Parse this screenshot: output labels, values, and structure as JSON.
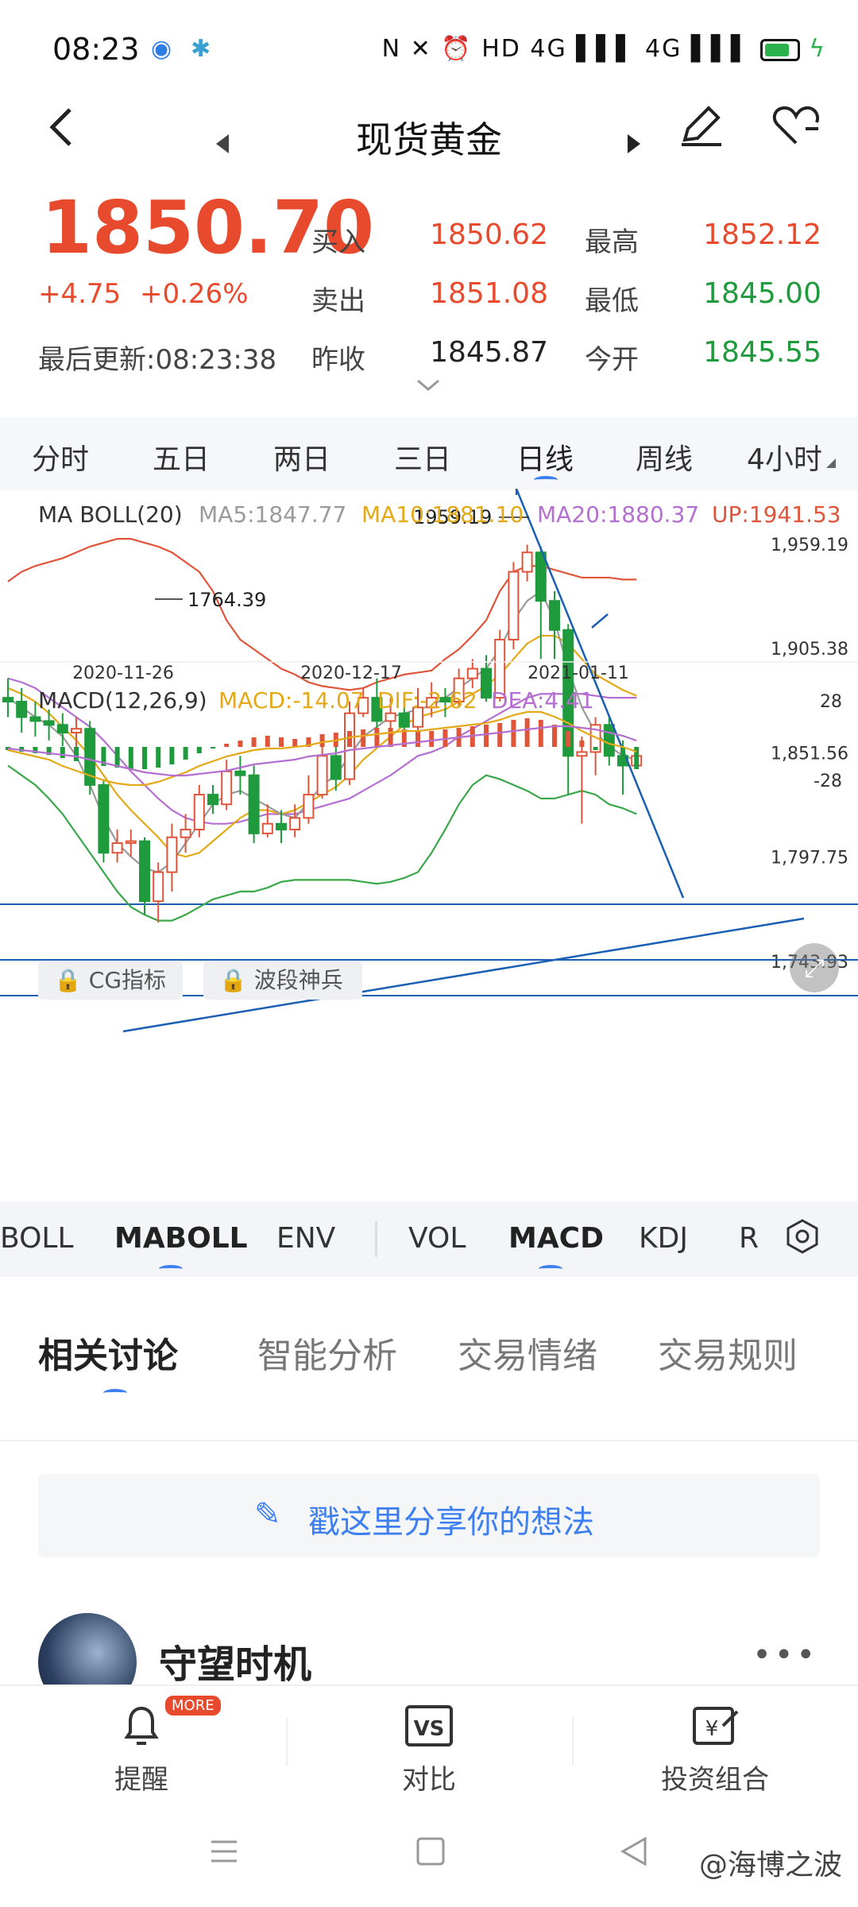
{
  "status_bar": {
    "time": "08:23",
    "right_icons": "N ✕ ⏰ HD 4G ▌▌▌ 4G ▌▌▌"
  },
  "nav": {
    "title": "现货黄金",
    "back_icon": "chevron-left-icon",
    "prev_icon": "triangle-left-icon",
    "next_icon": "triangle-right-icon",
    "edit_icon": "pen-icon",
    "fav_icon": "heart-icon"
  },
  "quote": {
    "price": "1850.70",
    "change": "+4.75",
    "change_pct": "+0.26%",
    "updated": "最后更新:08:23:38",
    "buy_label": "买入",
    "buy_value": "1850.62",
    "sell_label": "卖出",
    "sell_value": "1851.08",
    "prev_close_label": "昨收",
    "prev_close_value": "1845.87",
    "high_label": "最高",
    "high_value": "1852.12",
    "low_label": "最低",
    "low_value": "1845.00",
    "open_label": "今开",
    "open_value": "1845.55",
    "expand_icon": "chevron-down-icon"
  },
  "period_tabs": [
    "分时",
    "五日",
    "两日",
    "三日",
    "日线",
    "周线",
    "4小时"
  ],
  "period_active": "日线",
  "indicator_header": {
    "name": "MA BOLL(20)",
    "ma5": "MA5:1847.77",
    "ma10": "MA10:1881.10",
    "ma20": "MA20:1880.37",
    "up": "UP:1941.53"
  },
  "macd_header": {
    "name": "MACD(12,26,9)",
    "macd": "MACD:-14.07",
    "dif": "DIF:-2.62",
    "dea": "DEA:4.41"
  },
  "chart_badges": [
    "CG指标",
    "波段神兵"
  ],
  "colors": {
    "ma5": "#9a9a9a",
    "ma10": "#e3a917",
    "ma20": "#b46fd1",
    "up": "#e0553a",
    "low": "#3aa84a",
    "up_candle": "#e0553a",
    "down_candle": "#1f9a3c",
    "trend_line": "#1a5fb4"
  },
  "chart_data": {
    "type": "line",
    "price_axis": [
      "1,959.19",
      "1,905.38",
      "1,851.56",
      "1,797.75",
      "1,743.93"
    ],
    "date_axis": [
      "2020-11-26",
      "2020-12-17",
      "2021-01-11"
    ],
    "annotations": [
      "1959.19",
      "1764.39"
    ],
    "macd_axis": [
      "28",
      "-28"
    ],
    "candles": [
      [
        1880,
        1878,
        1890,
        1870
      ],
      [
        1878,
        1870,
        1885,
        1862
      ],
      [
        1870,
        1868,
        1878,
        1860
      ],
      [
        1868,
        1866,
        1874,
        1858
      ],
      [
        1866,
        1862,
        1872,
        1855
      ],
      [
        1862,
        1864,
        1870,
        1852
      ],
      [
        1864,
        1835,
        1868,
        1830
      ],
      [
        1835,
        1800,
        1838,
        1795
      ],
      [
        1800,
        1805,
        1812,
        1795
      ],
      [
        1805,
        1806,
        1812,
        1798
      ],
      [
        1806,
        1775,
        1808,
        1768
      ],
      [
        1775,
        1790,
        1795,
        1764
      ],
      [
        1790,
        1808,
        1815,
        1780
      ],
      [
        1808,
        1812,
        1820,
        1800
      ],
      [
        1812,
        1830,
        1835,
        1808
      ],
      [
        1830,
        1825,
        1835,
        1820
      ],
      [
        1825,
        1842,
        1848,
        1822
      ],
      [
        1842,
        1840,
        1850,
        1830
      ],
      [
        1840,
        1810,
        1845,
        1805
      ],
      [
        1810,
        1815,
        1825,
        1808
      ],
      [
        1815,
        1812,
        1822,
        1805
      ],
      [
        1812,
        1818,
        1825,
        1808
      ],
      [
        1818,
        1830,
        1840,
        1815
      ],
      [
        1830,
        1850,
        1860,
        1828
      ],
      [
        1850,
        1838,
        1855,
        1832
      ],
      [
        1838,
        1872,
        1878,
        1835
      ],
      [
        1872,
        1880,
        1885,
        1870
      ],
      [
        1880,
        1868,
        1890,
        1862
      ],
      [
        1868,
        1872,
        1880,
        1860
      ],
      [
        1872,
        1865,
        1880,
        1858
      ],
      [
        1865,
        1875,
        1885,
        1860
      ],
      [
        1875,
        1880,
        1888,
        1870
      ],
      [
        1880,
        1878,
        1885,
        1870
      ],
      [
        1878,
        1890,
        1895,
        1875
      ],
      [
        1890,
        1895,
        1900,
        1885
      ],
      [
        1895,
        1880,
        1902,
        1878
      ],
      [
        1880,
        1910,
        1915,
        1878
      ],
      [
        1910,
        1945,
        1950,
        1905
      ],
      [
        1945,
        1955,
        1959,
        1940
      ],
      [
        1955,
        1930,
        1958,
        1900
      ],
      [
        1930,
        1915,
        1935,
        1900
      ],
      [
        1915,
        1850,
        1918,
        1830
      ],
      [
        1850,
        1852,
        1860,
        1815
      ],
      [
        1852,
        1866,
        1870,
        1840
      ],
      [
        1866,
        1850,
        1870,
        1845
      ],
      [
        1850,
        1845,
        1858,
        1830
      ],
      [
        1845,
        1850,
        1852,
        1845
      ]
    ],
    "ma5": [
      1880,
      1875,
      1870,
      1866,
      1860,
      1850,
      1835,
      1818,
      1805,
      1798,
      1792,
      1790,
      1795,
      1805,
      1815,
      1825,
      1830,
      1832,
      1828,
      1824,
      1820,
      1818,
      1826,
      1835,
      1840,
      1850,
      1860,
      1865,
      1870,
      1872,
      1874,
      1876,
      1880,
      1885,
      1890,
      1895,
      1905,
      1920,
      1930,
      1935,
      1920,
      1895,
      1875,
      1862,
      1855,
      1850,
      1848
    ],
    "ma10": [
      1885,
      1882,
      1878,
      1872,
      1865,
      1858,
      1850,
      1840,
      1830,
      1822,
      1815,
      1808,
      1800,
      1798,
      1800,
      1806,
      1812,
      1818,
      1822,
      1822,
      1820,
      1822,
      1826,
      1830,
      1834,
      1840,
      1848,
      1854,
      1860,
      1866,
      1870,
      1872,
      1874,
      1878,
      1882,
      1886,
      1892,
      1900,
      1908,
      1912,
      1912,
      1908,
      1900,
      1892,
      1888,
      1884,
      1881
    ],
    "ma20": [
      1890,
      1888,
      1885,
      1880,
      1875,
      1870,
      1865,
      1858,
      1850,
      1842,
      1835,
      1828,
      1822,
      1818,
      1816,
      1815,
      1815,
      1816,
      1818,
      1820,
      1820,
      1820,
      1822,
      1824,
      1826,
      1828,
      1832,
      1836,
      1840,
      1845,
      1850,
      1852,
      1855,
      1860,
      1864,
      1868,
      1872,
      1876,
      1880,
      1882,
      1882,
      1882,
      1882,
      1881,
      1880,
      1880,
      1880
    ],
    "up": [
      1940,
      1945,
      1948,
      1950,
      1952,
      1955,
      1958,
      1960,
      1962,
      1962,
      1960,
      1958,
      1955,
      1950,
      1945,
      1935,
      1920,
      1910,
      1905,
      1900,
      1895,
      1892,
      1888,
      1886,
      1885,
      1884,
      1885,
      1888,
      1890,
      1892,
      1893,
      1894,
      1900,
      1905,
      1912,
      1920,
      1935,
      1945,
      1948,
      1948,
      1946,
      1944,
      1942,
      1942,
      1942,
      1941,
      1941
    ],
    "low": [
      1845,
      1840,
      1835,
      1828,
      1820,
      1810,
      1800,
      1790,
      1780,
      1772,
      1768,
      1765,
      1765,
      1768,
      1772,
      1776,
      1778,
      1780,
      1780,
      1782,
      1785,
      1786,
      1786,
      1786,
      1786,
      1786,
      1785,
      1784,
      1785,
      1787,
      1790,
      1800,
      1812,
      1825,
      1835,
      1840,
      1838,
      1835,
      1832,
      1828,
      1828,
      1830,
      1832,
      1830,
      1825,
      1823,
      1820
    ],
    "macd_hist": [
      -2,
      -3,
      -4,
      -5,
      -7,
      -9,
      -11,
      -12,
      -13,
      -14,
      -14,
      -13,
      -11,
      -8,
      -4,
      -1,
      2,
      4,
      6,
      7,
      6,
      5,
      6,
      8,
      9,
      10,
      11,
      12,
      12,
      11,
      10,
      10,
      11,
      12,
      13,
      14,
      15,
      17,
      18,
      17,
      14,
      10,
      4,
      -2,
      -6,
      -10,
      -14
    ],
    "dif": [
      -2,
      -4,
      -6,
      -8,
      -12,
      -15,
      -18,
      -21,
      -23,
      -24,
      -24,
      -22,
      -19,
      -16,
      -12,
      -9,
      -6,
      -4,
      -2,
      -1,
      -1,
      0,
      1,
      3,
      4,
      6,
      7,
      8,
      9,
      10,
      10,
      11,
      12,
      13,
      14,
      15,
      17,
      20,
      22,
      22,
      19,
      15,
      10,
      6,
      2,
      0,
      -3
    ],
    "dea": [
      -1,
      -2,
      -3,
      -4,
      -5,
      -6,
      -8,
      -10,
      -12,
      -14,
      -16,
      -17,
      -18,
      -18,
      -17,
      -16,
      -15,
      -13,
      -11,
      -10,
      -9,
      -8,
      -6,
      -5,
      -4,
      -2,
      -1,
      0,
      1,
      2,
      3,
      4,
      5,
      6,
      7,
      8,
      9,
      10,
      11,
      12,
      13,
      13,
      12,
      11,
      9,
      7,
      4
    ]
  },
  "indicator_tabs": [
    "BOLL",
    "MABOLL",
    "ENV",
    "VOL",
    "MACD",
    "KDJ",
    "R"
  ],
  "discussion_tabs": [
    "相关讨论",
    "智能分析",
    "交易情绪",
    "交易规则"
  ],
  "share_prompt": "戳这里分享你的想法",
  "post": {
    "username": "守望时机",
    "more": "•••"
  },
  "bottom_bar": {
    "remind": "提醒",
    "badge": "MORE",
    "compare": "对比",
    "portfolio": "投资组合",
    "vs": "VS"
  },
  "watermark": "@海博之波"
}
